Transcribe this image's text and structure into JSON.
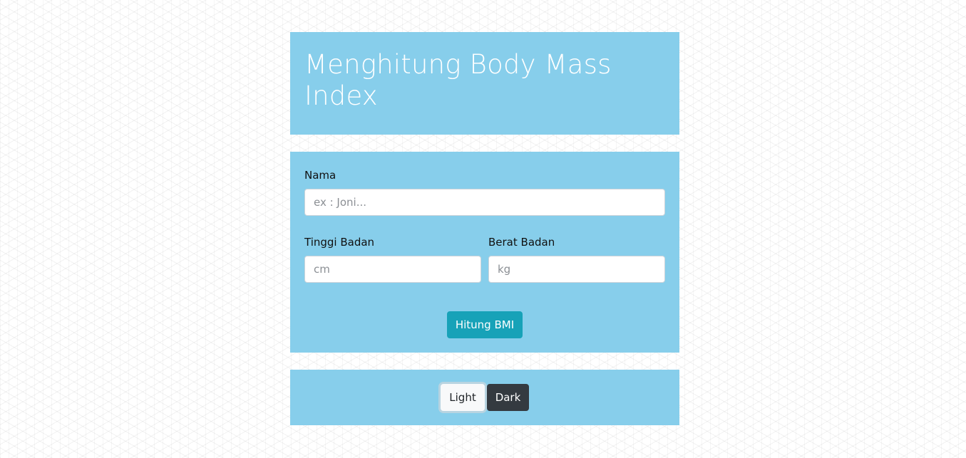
{
  "header": {
    "title": "Menghitung Body Mass Index"
  },
  "form": {
    "nama": {
      "label": "Nama",
      "value": "",
      "placeholder": "ex : Joni..."
    },
    "tinggi": {
      "label": "Tinggi Badan",
      "value": "",
      "placeholder": "cm"
    },
    "berat": {
      "label": "Berat Badan",
      "value": "",
      "placeholder": "kg"
    },
    "submit_label": "Hitung BMI"
  },
  "theme": {
    "light_label": "Light",
    "dark_label": "Dark"
  },
  "colors": {
    "panel": "#87ceeb",
    "primary_button": "#17a2b8",
    "dark_button": "#343a40",
    "light_button": "#f8f9fa"
  }
}
